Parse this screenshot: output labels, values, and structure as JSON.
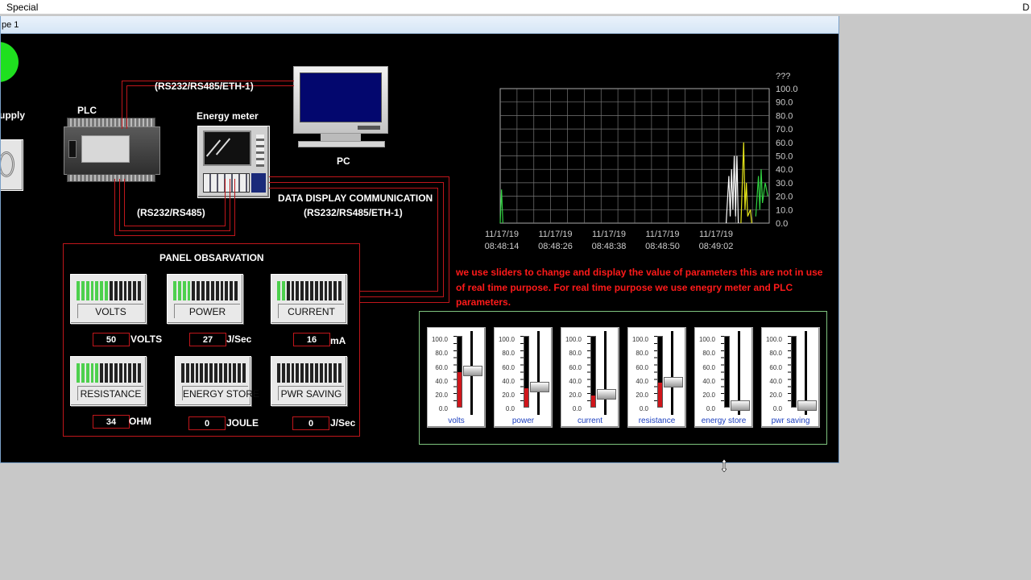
{
  "top_bar": {
    "menu": "Special",
    "right": "D"
  },
  "window": {
    "title": "pe 1"
  },
  "diagram": {
    "supply_label": "upply",
    "plc_label": "PLC",
    "energy_meter_label": "Energy meter",
    "pc_label": "PC",
    "link_top": "(RS232/RS485/ETH-1)",
    "link_bottom": "(RS232/RS485)",
    "data_display_line1": "DATA DISPLAY COMMUNICATION",
    "data_display_line2": "(RS232/RS485/ETH-1)"
  },
  "panel": {
    "title": "PANEL OBSARVATION",
    "indicators": [
      {
        "label": "VOLTS",
        "value": "50",
        "unit": "VOLTS",
        "level": 0.5
      },
      {
        "label": "POWER",
        "value": "27",
        "unit": "J/Sec",
        "level": 0.27
      },
      {
        "label": "CURRENT",
        "value": "16",
        "unit": "mA",
        "level": 0.16
      },
      {
        "label": "RESISTANCE",
        "value": "34",
        "unit": "OHM",
        "level": 0.34
      },
      {
        "label": "ENERGY STORE",
        "value": "0",
        "unit": "JOULE",
        "level": 0
      },
      {
        "label": "PWR SAVING",
        "value": "0",
        "unit": "J/Sec",
        "level": 0
      }
    ]
  },
  "note": " we use sliders to change and display the value of parameters this are not in use of real time purpose. For real time purpose we use enegry meter and PLC parameters.",
  "sliders": {
    "scale": [
      "100.0",
      "80.0",
      "60.0",
      "40.0",
      "20.0",
      "0.0"
    ],
    "items": [
      {
        "name": "volts",
        "value": 50
      },
      {
        "name": "power",
        "value": 27
      },
      {
        "name": "current",
        "value": 16
      },
      {
        "name": "resistance",
        "value": 34
      },
      {
        "name": "energy store",
        "value": 0
      },
      {
        "name": "pwr saving",
        "value": 0
      }
    ]
  },
  "trend": {
    "title": "???",
    "y_ticks": [
      "100.0",
      "90.0",
      "80.0",
      "70.0",
      "60.0",
      "50.0",
      "40.0",
      "30.0",
      "20.0",
      "10.0",
      "0.0"
    ],
    "x_ticks": [
      {
        "date": "11/17/19",
        "time": "08:48:14"
      },
      {
        "date": "11/17/19",
        "time": "08:48:26"
      },
      {
        "date": "11/17/19",
        "time": "08:48:38"
      },
      {
        "date": "11/17/19",
        "time": "08:48:50"
      },
      {
        "date": "11/17/19",
        "time": "08:49:02"
      }
    ]
  },
  "colors": {
    "wire": "#c0161b",
    "indicator_on": "#4dd04d",
    "note_text": "#ff1a1a",
    "slider_fill": "#d0161b"
  }
}
